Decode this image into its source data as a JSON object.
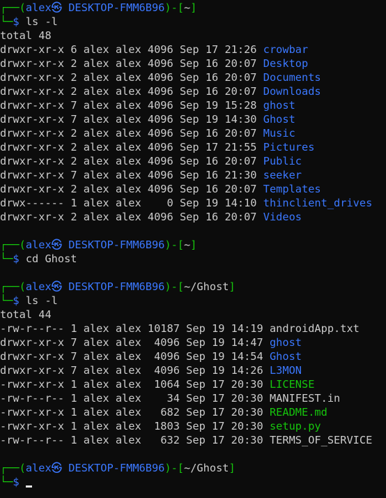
{
  "prompt": {
    "user": "alex",
    "sep": "㉿",
    "host": "DESKTOP-FMM6B96"
  },
  "blocks": [
    {
      "cwd": "~",
      "command": "ls -l",
      "total": "total 48",
      "name_col": 37,
      "entries": [
        {
          "perm": "drwxr-xr-x",
          "links": "6",
          "owner": "alex",
          "group": "alex",
          "size": "4096",
          "mon": "Sep",
          "day": "17",
          "time": "21:26",
          "name": "crowbar",
          "color": "#3b78ff"
        },
        {
          "perm": "drwxr-xr-x",
          "links": "2",
          "owner": "alex",
          "group": "alex",
          "size": "4096",
          "mon": "Sep",
          "day": "16",
          "time": "20:07",
          "name": "Desktop",
          "color": "#3b78ff"
        },
        {
          "perm": "drwxr-xr-x",
          "links": "2",
          "owner": "alex",
          "group": "alex",
          "size": "4096",
          "mon": "Sep",
          "day": "16",
          "time": "20:07",
          "name": "Documents",
          "color": "#3b78ff"
        },
        {
          "perm": "drwxr-xr-x",
          "links": "2",
          "owner": "alex",
          "group": "alex",
          "size": "4096",
          "mon": "Sep",
          "day": "16",
          "time": "20:07",
          "name": "Downloads",
          "color": "#3b78ff"
        },
        {
          "perm": "drwxr-xr-x",
          "links": "7",
          "owner": "alex",
          "group": "alex",
          "size": "4096",
          "mon": "Sep",
          "day": "19",
          "time": "15:28",
          "name": "ghost",
          "color": "#3b78ff"
        },
        {
          "perm": "drwxr-xr-x",
          "links": "7",
          "owner": "alex",
          "group": "alex",
          "size": "4096",
          "mon": "Sep",
          "day": "19",
          "time": "14:30",
          "name": "Ghost",
          "color": "#3b78ff"
        },
        {
          "perm": "drwxr-xr-x",
          "links": "2",
          "owner": "alex",
          "group": "alex",
          "size": "4096",
          "mon": "Sep",
          "day": "16",
          "time": "20:07",
          "name": "Music",
          "color": "#3b78ff"
        },
        {
          "perm": "drwxr-xr-x",
          "links": "2",
          "owner": "alex",
          "group": "alex",
          "size": "4096",
          "mon": "Sep",
          "day": "17",
          "time": "21:55",
          "name": "Pictures",
          "color": "#3b78ff"
        },
        {
          "perm": "drwxr-xr-x",
          "links": "2",
          "owner": "alex",
          "group": "alex",
          "size": "4096",
          "mon": "Sep",
          "day": "16",
          "time": "20:07",
          "name": "Public",
          "color": "#3b78ff"
        },
        {
          "perm": "drwxr-xr-x",
          "links": "7",
          "owner": "alex",
          "group": "alex",
          "size": "4096",
          "mon": "Sep",
          "day": "16",
          "time": "21:30",
          "name": "seeker",
          "color": "#3b78ff"
        },
        {
          "perm": "drwxr-xr-x",
          "links": "2",
          "owner": "alex",
          "group": "alex",
          "size": "4096",
          "mon": "Sep",
          "day": "16",
          "time": "20:07",
          "name": "Templates",
          "color": "#3b78ff"
        },
        {
          "perm": "drwx------",
          "links": "1",
          "owner": "alex",
          "group": "alex",
          "size": "0",
          "mon": "Sep",
          "day": "19",
          "time": "14:10",
          "name": "thinclient_drives",
          "color": "#3b78ff"
        },
        {
          "perm": "drwxr-xr-x",
          "links": "2",
          "owner": "alex",
          "group": "alex",
          "size": "4096",
          "mon": "Sep",
          "day": "16",
          "time": "20:07",
          "name": "Videos",
          "color": "#3b78ff"
        }
      ]
    },
    {
      "cwd": "~",
      "command": "cd Ghost"
    },
    {
      "cwd": "~/Ghost",
      "command": "ls -l",
      "total": "total 44",
      "name_col": 38,
      "entries": [
        {
          "perm": "-rw-r--r--",
          "links": "1",
          "owner": "alex",
          "group": "alex",
          "size": "10187",
          "mon": "Sep",
          "day": "19",
          "time": "14:19",
          "name": "androidApp.txt",
          "color": "#cccccc"
        },
        {
          "perm": "drwxr-xr-x",
          "links": "7",
          "owner": "alex",
          "group": "alex",
          "size": "4096",
          "mon": "Sep",
          "day": "19",
          "time": "14:47",
          "name": "ghost",
          "color": "#3b78ff"
        },
        {
          "perm": "drwxr-xr-x",
          "links": "7",
          "owner": "alex",
          "group": "alex",
          "size": "4096",
          "mon": "Sep",
          "day": "19",
          "time": "14:54",
          "name": "Ghost",
          "color": "#3b78ff"
        },
        {
          "perm": "drwxr-xr-x",
          "links": "7",
          "owner": "alex",
          "group": "alex",
          "size": "4096",
          "mon": "Sep",
          "day": "19",
          "time": "14:26",
          "name": "L3MON",
          "color": "#3b78ff"
        },
        {
          "perm": "-rwxr-xr-x",
          "links": "1",
          "owner": "alex",
          "group": "alex",
          "size": "1064",
          "mon": "Sep",
          "day": "17",
          "time": "20:30",
          "name": "LICENSE",
          "color": "#16c60c"
        },
        {
          "perm": "-rw-r--r--",
          "links": "1",
          "owner": "alex",
          "group": "alex",
          "size": "34",
          "mon": "Sep",
          "day": "17",
          "time": "20:30",
          "name": "MANIFEST.in",
          "color": "#cccccc"
        },
        {
          "perm": "-rwxr-xr-x",
          "links": "1",
          "owner": "alex",
          "group": "alex",
          "size": "682",
          "mon": "Sep",
          "day": "17",
          "time": "20:30",
          "name": "README.md",
          "color": "#16c60c"
        },
        {
          "perm": "-rwxr-xr-x",
          "links": "1",
          "owner": "alex",
          "group": "alex",
          "size": "1803",
          "mon": "Sep",
          "day": "17",
          "time": "20:30",
          "name": "setup.py",
          "color": "#16c60c"
        },
        {
          "perm": "-rw-r--r--",
          "links": "1",
          "owner": "alex",
          "group": "alex",
          "size": "632",
          "mon": "Sep",
          "day": "17",
          "time": "20:30",
          "name": "TERMS_OF_SERVICE",
          "color": "#cccccc"
        }
      ]
    },
    {
      "cwd": "~/Ghost",
      "command": "",
      "cursor": true
    }
  ],
  "colors": {
    "background": "#0c0c0c",
    "text": "#cccccc",
    "prompt_frame": "#16c60c",
    "prompt_host": "#3b78ff",
    "directory": "#3b78ff",
    "executable": "#16c60c"
  }
}
